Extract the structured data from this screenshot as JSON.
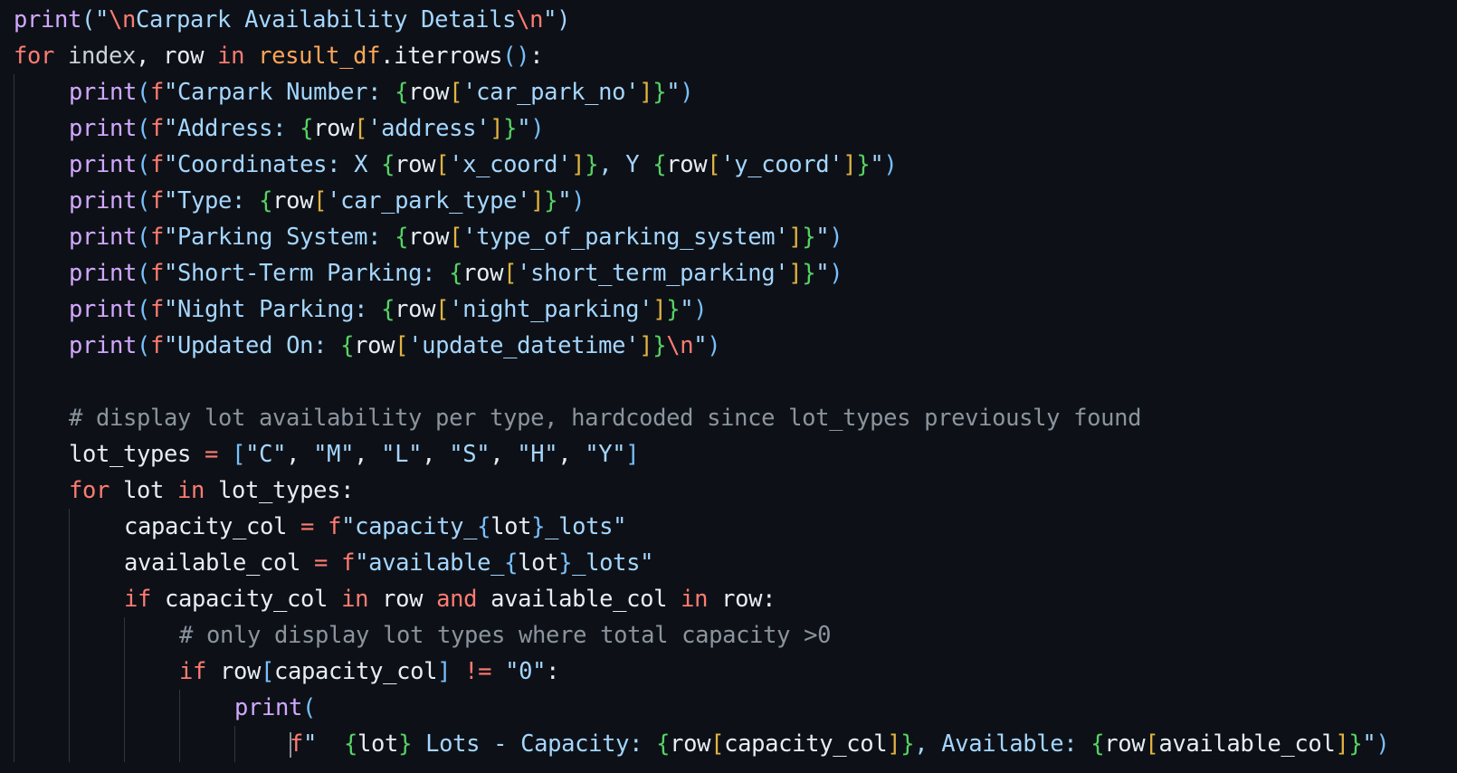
{
  "editor": {
    "language": "python",
    "theme_colors": {
      "background": "#0d1117",
      "function": "#d2a8ff",
      "keyword": "#ff7b72",
      "string": "#a5d6ff",
      "comment": "#8b949e",
      "bracket_level_1": "#79c0ff",
      "bracket_level_2": "#56d364",
      "bracket_level_3": "#e3b341"
    },
    "lines": [
      {
        "indent": 0,
        "tokens": [
          {
            "t": "print",
            "c": "fn"
          },
          {
            "t": "(\"",
            "c": "str"
          },
          {
            "t": "\\n",
            "c": "esc"
          },
          {
            "t": "Carpark Availability Details",
            "c": "str"
          },
          {
            "t": "\\n",
            "c": "esc"
          },
          {
            "t": "\")",
            "c": "str"
          }
        ]
      },
      {
        "indent": 0,
        "tokens": [
          {
            "t": "for",
            "c": "kw"
          },
          {
            "t": " ",
            "c": "var"
          },
          {
            "t": "index",
            "c": "dim"
          },
          {
            "t": ", ",
            "c": "var"
          },
          {
            "t": "row",
            "c": "var"
          },
          {
            "t": " ",
            "c": "var"
          },
          {
            "t": "in",
            "c": "kw"
          },
          {
            "t": " ",
            "c": "var"
          },
          {
            "t": "result_df",
            "c": "cls"
          },
          {
            "t": ".iterrows",
            "c": "var"
          },
          {
            "t": "()",
            "c": "p1"
          },
          {
            "t": ":",
            "c": "var"
          }
        ]
      },
      {
        "indent": 1,
        "tokens": [
          {
            "t": "print",
            "c": "fn"
          },
          {
            "t": "(",
            "c": "p1"
          },
          {
            "t": "f",
            "c": "kw"
          },
          {
            "t": "\"Carpark Number: ",
            "c": "str"
          },
          {
            "t": "{",
            "c": "p2"
          },
          {
            "t": "row",
            "c": "var"
          },
          {
            "t": "[",
            "c": "p3"
          },
          {
            "t": "'car_park_no'",
            "c": "str"
          },
          {
            "t": "]",
            "c": "p3"
          },
          {
            "t": "}",
            "c": "p2"
          },
          {
            "t": "\"",
            "c": "str"
          },
          {
            "t": ")",
            "c": "p1"
          }
        ]
      },
      {
        "indent": 1,
        "tokens": [
          {
            "t": "print",
            "c": "fn"
          },
          {
            "t": "(",
            "c": "p1"
          },
          {
            "t": "f",
            "c": "kw"
          },
          {
            "t": "\"Address: ",
            "c": "str"
          },
          {
            "t": "{",
            "c": "p2"
          },
          {
            "t": "row",
            "c": "var"
          },
          {
            "t": "[",
            "c": "p3"
          },
          {
            "t": "'address'",
            "c": "str"
          },
          {
            "t": "]",
            "c": "p3"
          },
          {
            "t": "}",
            "c": "p2"
          },
          {
            "t": "\"",
            "c": "str"
          },
          {
            "t": ")",
            "c": "p1"
          }
        ]
      },
      {
        "indent": 1,
        "tokens": [
          {
            "t": "print",
            "c": "fn"
          },
          {
            "t": "(",
            "c": "p1"
          },
          {
            "t": "f",
            "c": "kw"
          },
          {
            "t": "\"Coordinates: X ",
            "c": "str"
          },
          {
            "t": "{",
            "c": "p2"
          },
          {
            "t": "row",
            "c": "var"
          },
          {
            "t": "[",
            "c": "p3"
          },
          {
            "t": "'x_coord'",
            "c": "str"
          },
          {
            "t": "]",
            "c": "p3"
          },
          {
            "t": "}",
            "c": "p2"
          },
          {
            "t": ", Y ",
            "c": "str"
          },
          {
            "t": "{",
            "c": "p2"
          },
          {
            "t": "row",
            "c": "var"
          },
          {
            "t": "[",
            "c": "p3"
          },
          {
            "t": "'y_coord'",
            "c": "str"
          },
          {
            "t": "]",
            "c": "p3"
          },
          {
            "t": "}",
            "c": "p2"
          },
          {
            "t": "\"",
            "c": "str"
          },
          {
            "t": ")",
            "c": "p1"
          }
        ]
      },
      {
        "indent": 1,
        "tokens": [
          {
            "t": "print",
            "c": "fn"
          },
          {
            "t": "(",
            "c": "p1"
          },
          {
            "t": "f",
            "c": "kw"
          },
          {
            "t": "\"Type: ",
            "c": "str"
          },
          {
            "t": "{",
            "c": "p2"
          },
          {
            "t": "row",
            "c": "var"
          },
          {
            "t": "[",
            "c": "p3"
          },
          {
            "t": "'car_park_type'",
            "c": "str"
          },
          {
            "t": "]",
            "c": "p3"
          },
          {
            "t": "}",
            "c": "p2"
          },
          {
            "t": "\"",
            "c": "str"
          },
          {
            "t": ")",
            "c": "p1"
          }
        ]
      },
      {
        "indent": 1,
        "tokens": [
          {
            "t": "print",
            "c": "fn"
          },
          {
            "t": "(",
            "c": "p1"
          },
          {
            "t": "f",
            "c": "kw"
          },
          {
            "t": "\"Parking System: ",
            "c": "str"
          },
          {
            "t": "{",
            "c": "p2"
          },
          {
            "t": "row",
            "c": "var"
          },
          {
            "t": "[",
            "c": "p3"
          },
          {
            "t": "'type_of_parking_system'",
            "c": "str"
          },
          {
            "t": "]",
            "c": "p3"
          },
          {
            "t": "}",
            "c": "p2"
          },
          {
            "t": "\"",
            "c": "str"
          },
          {
            "t": ")",
            "c": "p1"
          }
        ]
      },
      {
        "indent": 1,
        "tokens": [
          {
            "t": "print",
            "c": "fn"
          },
          {
            "t": "(",
            "c": "p1"
          },
          {
            "t": "f",
            "c": "kw"
          },
          {
            "t": "\"Short-Term Parking: ",
            "c": "str"
          },
          {
            "t": "{",
            "c": "p2"
          },
          {
            "t": "row",
            "c": "var"
          },
          {
            "t": "[",
            "c": "p3"
          },
          {
            "t": "'short_term_parking'",
            "c": "str"
          },
          {
            "t": "]",
            "c": "p3"
          },
          {
            "t": "}",
            "c": "p2"
          },
          {
            "t": "\"",
            "c": "str"
          },
          {
            "t": ")",
            "c": "p1"
          }
        ]
      },
      {
        "indent": 1,
        "tokens": [
          {
            "t": "print",
            "c": "fn"
          },
          {
            "t": "(",
            "c": "p1"
          },
          {
            "t": "f",
            "c": "kw"
          },
          {
            "t": "\"Night Parking: ",
            "c": "str"
          },
          {
            "t": "{",
            "c": "p2"
          },
          {
            "t": "row",
            "c": "var"
          },
          {
            "t": "[",
            "c": "p3"
          },
          {
            "t": "'night_parking'",
            "c": "str"
          },
          {
            "t": "]",
            "c": "p3"
          },
          {
            "t": "}",
            "c": "p2"
          },
          {
            "t": "\"",
            "c": "str"
          },
          {
            "t": ")",
            "c": "p1"
          }
        ]
      },
      {
        "indent": 1,
        "tokens": [
          {
            "t": "print",
            "c": "fn"
          },
          {
            "t": "(",
            "c": "p1"
          },
          {
            "t": "f",
            "c": "kw"
          },
          {
            "t": "\"Updated On: ",
            "c": "str"
          },
          {
            "t": "{",
            "c": "p2"
          },
          {
            "t": "row",
            "c": "var"
          },
          {
            "t": "[",
            "c": "p3"
          },
          {
            "t": "'update_datetime'",
            "c": "str"
          },
          {
            "t": "]",
            "c": "p3"
          },
          {
            "t": "}",
            "c": "p2"
          },
          {
            "t": "\\n",
            "c": "esc"
          },
          {
            "t": "\"",
            "c": "str"
          },
          {
            "t": ")",
            "c": "p1"
          }
        ]
      },
      {
        "indent": 1,
        "tokens": []
      },
      {
        "indent": 1,
        "tokens": [
          {
            "t": "# display lot availability per type, hardcoded since lot_types previously found",
            "c": "cm"
          }
        ]
      },
      {
        "indent": 1,
        "tokens": [
          {
            "t": "lot_types",
            "c": "var"
          },
          {
            "t": " ",
            "c": "var"
          },
          {
            "t": "=",
            "c": "op"
          },
          {
            "t": " ",
            "c": "var"
          },
          {
            "t": "[",
            "c": "p1"
          },
          {
            "t": "\"C\"",
            "c": "str"
          },
          {
            "t": ", ",
            "c": "var"
          },
          {
            "t": "\"M\"",
            "c": "str"
          },
          {
            "t": ", ",
            "c": "var"
          },
          {
            "t": "\"L\"",
            "c": "str"
          },
          {
            "t": ", ",
            "c": "var"
          },
          {
            "t": "\"S\"",
            "c": "str"
          },
          {
            "t": ", ",
            "c": "var"
          },
          {
            "t": "\"H\"",
            "c": "str"
          },
          {
            "t": ", ",
            "c": "var"
          },
          {
            "t": "\"Y\"",
            "c": "str"
          },
          {
            "t": "]",
            "c": "p1"
          }
        ]
      },
      {
        "indent": 1,
        "tokens": [
          {
            "t": "for",
            "c": "kw"
          },
          {
            "t": " lot ",
            "c": "var"
          },
          {
            "t": "in",
            "c": "kw"
          },
          {
            "t": " lot_types:",
            "c": "var"
          }
        ]
      },
      {
        "indent": 2,
        "tokens": [
          {
            "t": "capacity_col",
            "c": "var"
          },
          {
            "t": " ",
            "c": "var"
          },
          {
            "t": "=",
            "c": "op"
          },
          {
            "t": " ",
            "c": "var"
          },
          {
            "t": "f",
            "c": "kw"
          },
          {
            "t": "\"capacity_",
            "c": "str"
          },
          {
            "t": "{",
            "c": "p1"
          },
          {
            "t": "lot",
            "c": "var"
          },
          {
            "t": "}",
            "c": "p1"
          },
          {
            "t": "_lots\"",
            "c": "str"
          }
        ]
      },
      {
        "indent": 2,
        "tokens": [
          {
            "t": "available_col",
            "c": "var"
          },
          {
            "t": " ",
            "c": "var"
          },
          {
            "t": "=",
            "c": "op"
          },
          {
            "t": " ",
            "c": "var"
          },
          {
            "t": "f",
            "c": "kw"
          },
          {
            "t": "\"available_",
            "c": "str"
          },
          {
            "t": "{",
            "c": "p1"
          },
          {
            "t": "lot",
            "c": "var"
          },
          {
            "t": "}",
            "c": "p1"
          },
          {
            "t": "_lots\"",
            "c": "str"
          }
        ]
      },
      {
        "indent": 2,
        "tokens": [
          {
            "t": "if",
            "c": "kw"
          },
          {
            "t": " capacity_col ",
            "c": "var"
          },
          {
            "t": "in",
            "c": "kw"
          },
          {
            "t": " row ",
            "c": "var"
          },
          {
            "t": "and",
            "c": "kw"
          },
          {
            "t": " available_col ",
            "c": "var"
          },
          {
            "t": "in",
            "c": "kw"
          },
          {
            "t": " row:",
            "c": "var"
          }
        ]
      },
      {
        "indent": 3,
        "tokens": [
          {
            "t": "# only display lot types where total capacity >0",
            "c": "cm"
          }
        ]
      },
      {
        "indent": 3,
        "tokens": [
          {
            "t": "if",
            "c": "kw"
          },
          {
            "t": " row",
            "c": "var"
          },
          {
            "t": "[",
            "c": "p1"
          },
          {
            "t": "capacity_col",
            "c": "var"
          },
          {
            "t": "]",
            "c": "p1"
          },
          {
            "t": " ",
            "c": "var"
          },
          {
            "t": "!=",
            "c": "op"
          },
          {
            "t": " ",
            "c": "var"
          },
          {
            "t": "\"0\"",
            "c": "str"
          },
          {
            "t": ":",
            "c": "var"
          }
        ]
      },
      {
        "indent": 4,
        "tokens": [
          {
            "t": "print",
            "c": "fn"
          },
          {
            "t": "(",
            "c": "p1"
          }
        ]
      },
      {
        "indent": 5,
        "cursor": true,
        "tokens": [
          {
            "t": "f",
            "c": "kw"
          },
          {
            "t": "\"  ",
            "c": "str"
          },
          {
            "t": "{",
            "c": "p2"
          },
          {
            "t": "lot",
            "c": "var"
          },
          {
            "t": "}",
            "c": "p2"
          },
          {
            "t": " Lots - Capacity: ",
            "c": "str"
          },
          {
            "t": "{",
            "c": "p2"
          },
          {
            "t": "row",
            "c": "var"
          },
          {
            "t": "[",
            "c": "p3"
          },
          {
            "t": "capacity_col",
            "c": "var"
          },
          {
            "t": "]",
            "c": "p3"
          },
          {
            "t": "}",
            "c": "p2"
          },
          {
            "t": ", Available: ",
            "c": "str"
          },
          {
            "t": "{",
            "c": "p2"
          },
          {
            "t": "row",
            "c": "var"
          },
          {
            "t": "[",
            "c": "p3"
          },
          {
            "t": "available_col",
            "c": "var"
          },
          {
            "t": "]",
            "c": "p3"
          },
          {
            "t": "}",
            "c": "p2"
          },
          {
            "t": "\"",
            "c": "str"
          },
          {
            "t": ")",
            "c": "p1"
          }
        ]
      }
    ]
  }
}
